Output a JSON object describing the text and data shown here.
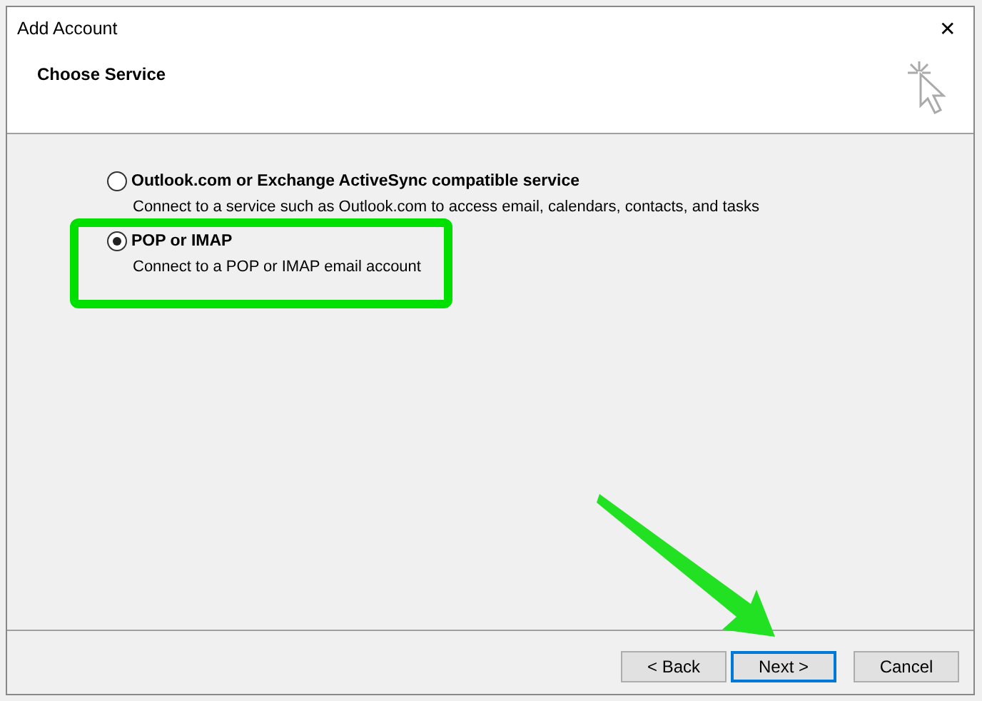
{
  "window": {
    "title": "Add Account",
    "close_icon": "✕"
  },
  "header": {
    "title": "Choose Service"
  },
  "options": [
    {
      "label": "Outlook.com or Exchange ActiveSync compatible service",
      "description": "Connect to a service such as Outlook.com to access email, calendars, contacts, and tasks",
      "selected": false
    },
    {
      "label": "POP or IMAP",
      "description": "Connect to a POP or IMAP email account",
      "selected": true
    }
  ],
  "buttons": [
    {
      "label": "< Back",
      "default": false
    },
    {
      "label": "Next >",
      "default": true
    },
    {
      "label": "Cancel",
      "default": false
    }
  ],
  "annotations": {
    "highlight_box": true,
    "arrow": true
  }
}
